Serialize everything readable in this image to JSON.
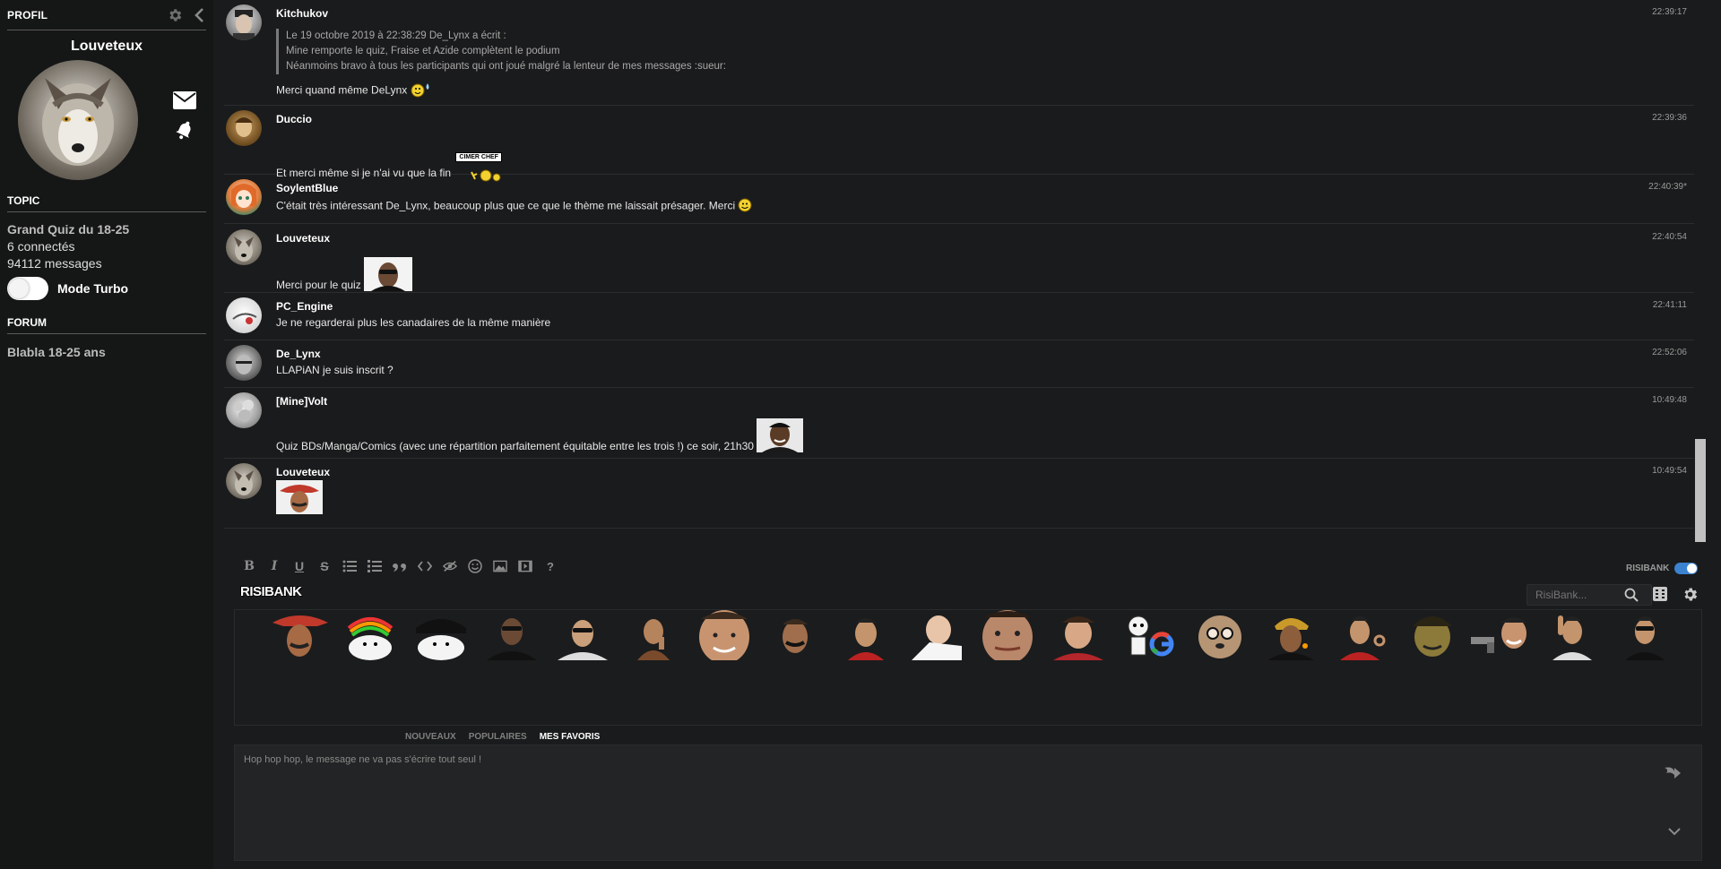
{
  "sidebar": {
    "profile_title": "PROFIL",
    "username": "Louveteux",
    "topic_section": "TOPIC",
    "topic_name": "Grand Quiz du 18-25",
    "connected": "6 connectés",
    "messages_count": "94112 messages",
    "turbo_label": "Mode Turbo",
    "forum_section": "FORUM",
    "forum_name": "Blabla 18-25 ans"
  },
  "messages": [
    {
      "author": "Kitchukov",
      "time": "22:39:17",
      "quote_header": "Le 19 octobre 2019 à 22:38:29 De_Lynx a écrit :",
      "quote_line1": "Mine remporte le quiz, Fraise et Azide complètent le podium",
      "quote_line2": "Néanmoins bravo à tous les participants qui ont joué malgré la lenteur de mes messages :sueur:",
      "text": "Merci quand même DeLynx"
    },
    {
      "author": "Duccio",
      "time": "22:39:36",
      "text": "Et merci même si je n'ai vu que la fin",
      "sticker_caption": "CIMER CHEF"
    },
    {
      "author": "SoylentBlue",
      "time": "22:40:39*",
      "text": "C'était très intéressant De_Lynx, beaucoup plus que ce que le thème me laissait présager. Merci"
    },
    {
      "author": "Louveteux",
      "time": "22:40:54",
      "text": "Merci pour le quiz"
    },
    {
      "author": "PC_Engine",
      "time": "22:41:11",
      "text": "Je ne regarderai plus les canadaires de la même manière"
    },
    {
      "author": "De_Lynx",
      "time": "22:52:06",
      "text": "LLAPiAN je suis inscrit ?"
    },
    {
      "author": "[Mine]Volt",
      "time": "10:49:48",
      "text": "Quiz BDs/Manga/Comics (avec une répartition parfaitement équitable entre les trois !) ce soir, 21h30"
    },
    {
      "author": "Louveteux",
      "time": "10:49:54",
      "text": ""
    }
  ],
  "composer": {
    "toolbar": [
      "B",
      "I",
      "U",
      "S",
      "list",
      "ordered-list",
      "quote",
      "code",
      "spoiler",
      "emoji",
      "image",
      "video",
      "?"
    ],
    "risibank_label": "RISIBANK",
    "risibank_logo": "RISIBANK",
    "search_placeholder": "RisiBank...",
    "tabs": [
      "NOUVEAUX",
      "POPULAIRES",
      "MES FAVORIS"
    ],
    "active_tab": "MES FAVORIS",
    "message_placeholder": "Hop hop hop, le message ne va pas s'écrire tout seul !"
  },
  "colors": {
    "background": "#1a1b1c",
    "sidebar": "#151616",
    "accent": "#3b83d1"
  }
}
